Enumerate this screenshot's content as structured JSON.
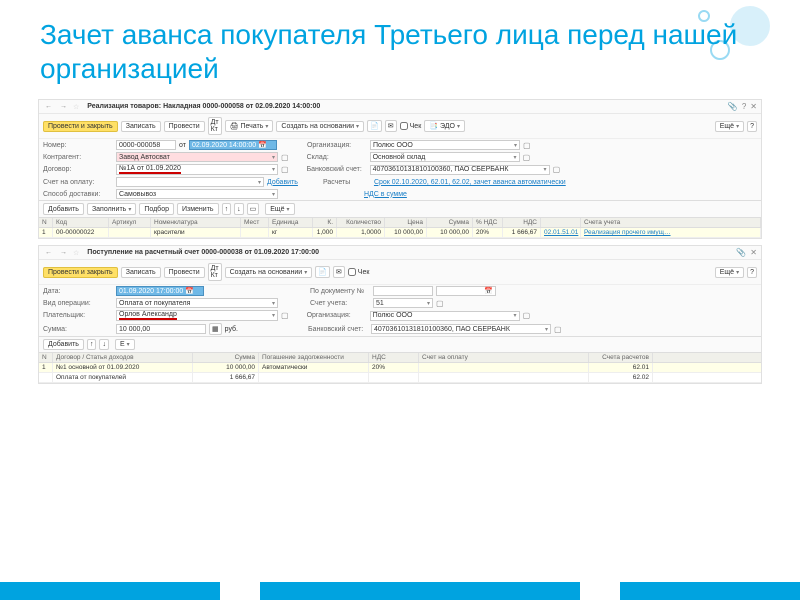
{
  "slide_title": "Зачет аванса покупателя Третьего лица перед нашей организацией",
  "panel1": {
    "title": "Реализация товаров: Накладная 0000-000058 от 02.09.2020 14:00:00",
    "btn_post_close": "Провести и закрыть",
    "btn_write": "Записать",
    "btn_post": "Провести",
    "btn_print": "Печать",
    "btn_create_based": "Создать на основании",
    "chk_check": "Чек",
    "btn_edo": "ЭДО",
    "btn_more": "Ещё",
    "lbl_number": "Номер:",
    "val_number": "0000-000058",
    "lbl_ot": "от",
    "val_date": "02.09.2020 14:00:00",
    "lbl_org": "Организация:",
    "val_org": "Полюс ООО",
    "lbl_contr": "Контрагент:",
    "val_contr": "Завод Автосват",
    "lbl_sklad": "Склад:",
    "val_sklad": "Основной склад",
    "lbl_dogovor": "Договор:",
    "val_dogovor": "№1А от 01.09.2020",
    "lbl_bank": "Банковский счет:",
    "val_bank": "40703610131810100360, ПАО СБЕРБАНК",
    "lbl_invoice": "Счет на оплату:",
    "link_add": "Добавить",
    "lbl_raschety": "Расчеты",
    "val_raschety": "Срок 02.10.2020, 62.01, 62.02, зачет аванса автоматически",
    "lbl_delivery": "Способ доставки:",
    "val_delivery": "Самовывоз",
    "link_nds": "НДС в сумме",
    "tb_add": "Добавить",
    "tb_fill": "Заполнить",
    "tb_select": "Подбор",
    "tb_change": "Изменить",
    "head": [
      "N",
      "Код",
      "Артикул",
      "Номенклатура",
      "Мест",
      "Единица",
      "К.",
      "Количество",
      "Цена",
      "Сумма",
      "% НДС",
      "НДС",
      "Счета учета"
    ],
    "row": {
      "n": "1",
      "kod": "00-00000022",
      "nom": "красители",
      "ed": "кг",
      "k": "1,000",
      "kol": "1,0000",
      "cena": "10 000,00",
      "sum": "10 000,00",
      "nds": "20%",
      "ndsv": "1 666,67",
      "acc1": "02.01.51.01",
      "acc2": "Реализация прочего имущ…"
    }
  },
  "panel2": {
    "title": "Поступление на расчетный счет 0000-000038 от 01.09.2020 17:00:00",
    "btn_post_close": "Провести и закрыть",
    "btn_write": "Записать",
    "btn_post": "Провести",
    "btn_create_based": "Создать на основании",
    "chk_check": "Чек",
    "btn_more": "Ещё",
    "lbl_date": "Дата:",
    "val_date": "01.09.2020 17:00:00",
    "lbl_podoc": "По документу №",
    "lbl_vid": "Вид операции:",
    "val_vid": "Оплата от покупателя",
    "lbl_acct": "Счет учета:",
    "val_acct": "51",
    "lbl_payer": "Плательщик:",
    "val_payer": "Орлов Александр",
    "lbl_org": "Организация:",
    "val_org": "Полюс ООО",
    "lbl_summa": "Сумма:",
    "val_summa": "10 000,00",
    "val_cur": "руб.",
    "lbl_bank": "Банковский счет:",
    "val_bank": "40703610131810100360, ПАО СБЕРБАНК",
    "tb_add": "Добавить",
    "head": [
      "N",
      "Договор / Статья доходов",
      "Сумма",
      "Погашение задолженности",
      "НДС",
      "Счет на оплату",
      "Счета расчетов"
    ],
    "row1": {
      "n": "1",
      "dog": "№1 основной от 01.09.2020",
      "sum": "10 000,00",
      "pog": "Автоматически",
      "nds": "20%",
      "acc": "62.01"
    },
    "row2": {
      "dog": "Оплата от покупателей",
      "sum": "1 666,67",
      "acc": "62.02"
    }
  }
}
